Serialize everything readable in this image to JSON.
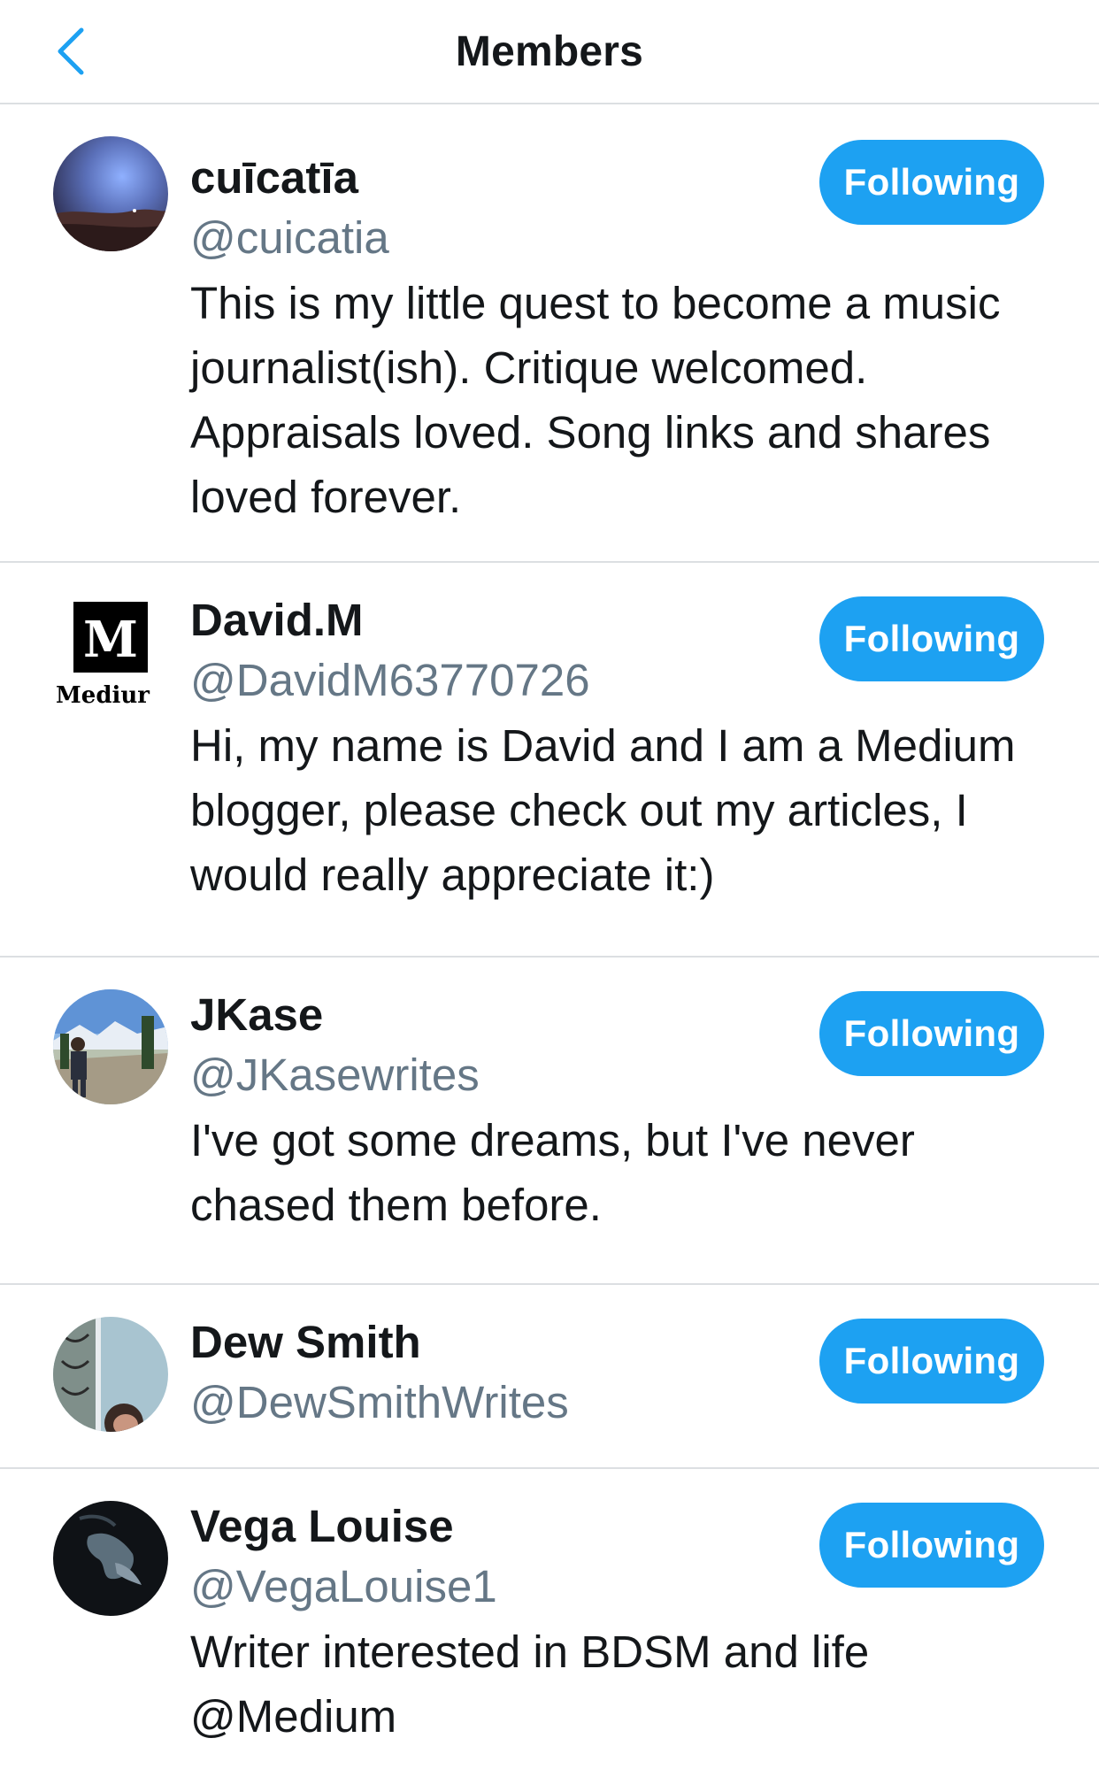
{
  "header": {
    "title": "Members",
    "back_icon": "chevron-left-icon"
  },
  "colors": {
    "accent": "#1da1f2",
    "divider": "#dcdfe2",
    "secondary_text": "#657786",
    "primary_text": "#14171a"
  },
  "members": [
    {
      "name": "cuīcatīa",
      "handle": "@cuicatia",
      "bio": "This is my little quest to become a music journalist(ish). Critique welcomed. Appraisals loved. Song links and shares loved forever.",
      "button": "Following"
    },
    {
      "name": "David.M",
      "handle": "@DavidM63770726",
      "bio": "Hi, my name is David and I am a Medium blogger, please check out my articles, I would really appreciate it:)",
      "button": "Following",
      "avatar_text": "M",
      "avatar_caption": "Mediur"
    },
    {
      "name": "JKase",
      "handle": "@JKasewrites",
      "bio": "I've got some dreams, but I've never chased them before.",
      "button": "Following"
    },
    {
      "name": "Dew Smith",
      "handle": "@DewSmithWrites",
      "bio": "",
      "button": "Following"
    },
    {
      "name": "Vega Louise",
      "handle": "@VegaLouise1",
      "bio": "Writer interested in BDSM and life @Medium",
      "button": "Following"
    }
  ]
}
